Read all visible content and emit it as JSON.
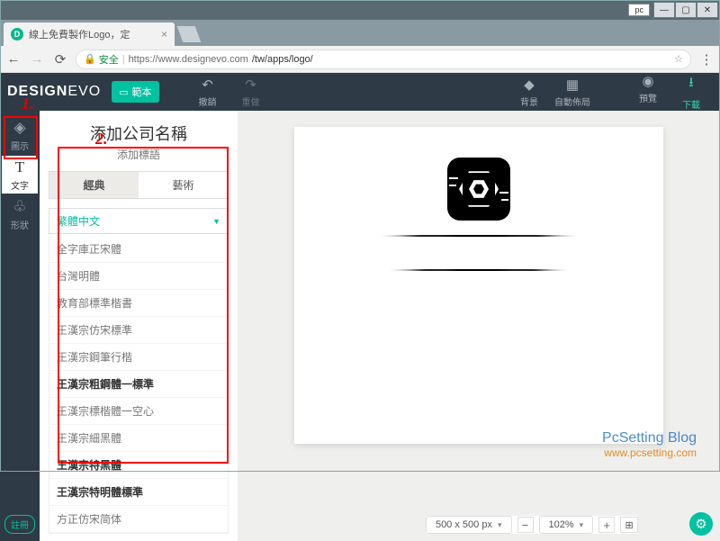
{
  "window": {
    "pc_tag": "pc"
  },
  "browser": {
    "tab_title": "線上免費製作Logo，定",
    "secure_label": "安全",
    "url_host": "https://www.designevo.com",
    "url_path": "/tw/apps/logo/"
  },
  "toolbar": {
    "brand_a": "DESIGN",
    "brand_b": "EVO",
    "template": "範本",
    "undo": "撤銷",
    "redo": "重做",
    "background": "背景",
    "layout": "自動佈局",
    "preview": "預覽",
    "download": "下載"
  },
  "rail": {
    "icon": "圖示",
    "text": "文字",
    "shape": "形狀",
    "register": "註冊"
  },
  "panel": {
    "add_name": "添加公司名稱",
    "add_slogan": "添加標語",
    "tab_classic": "經典",
    "tab_art": "藝術",
    "lang_selected": "繁體中文",
    "fonts": [
      {
        "label": "全字庫正宋體",
        "bold": false
      },
      {
        "label": "台灣明體",
        "bold": false
      },
      {
        "label": "教育部標準楷書",
        "bold": false
      },
      {
        "label": "王漢宗仿宋標準",
        "bold": false
      },
      {
        "label": "王漢宗鋼筆行楷",
        "bold": false
      },
      {
        "label": "王漢宗粗鋼體一標準",
        "bold": true
      },
      {
        "label": "王漢宗標楷體一空心",
        "bold": false
      },
      {
        "label": "王漢宗細黑體",
        "bold": false
      },
      {
        "label": "王漢宗特黑體",
        "bold": true
      },
      {
        "label": "王漢宗特明體標準",
        "bold": true
      },
      {
        "label": "方正仿宋简体",
        "bold": false
      }
    ]
  },
  "canvas": {
    "size_label": "500 x 500 px",
    "zoom": "102%"
  },
  "annot": {
    "n1": "1.",
    "n2": "2."
  },
  "watermark": {
    "line1": "PcSetting Blog",
    "line2": "www.pcsetting.com"
  }
}
